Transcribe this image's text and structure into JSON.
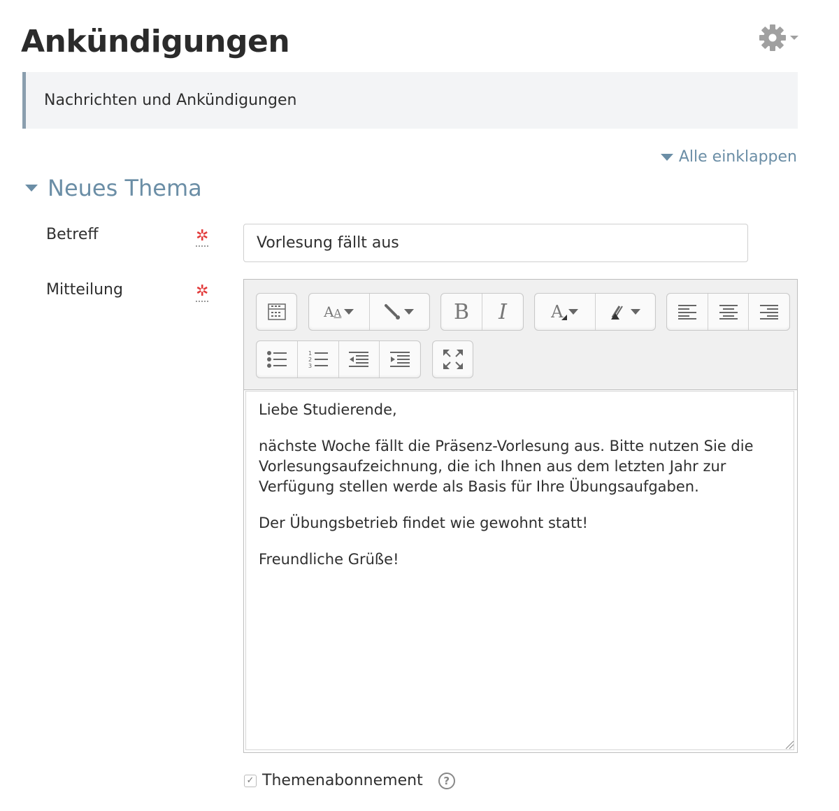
{
  "page": {
    "title": "Ankündigungen",
    "description": "Nachrichten und Ankündigungen",
    "settings_icon": "gear-icon"
  },
  "form": {
    "collapse_all": "Alle einklappen",
    "section_title": "Neues Thema",
    "subject": {
      "label": "Betreff",
      "value": "Vorlesung fällt aus",
      "required_marker": "✲"
    },
    "message": {
      "label": "Mitteilung",
      "required_marker": "✲",
      "paragraphs": [
        "Liebe Studierende,",
        "nächste Woche fällt die Präsenz-Vorlesung aus. Bitte nutzen Sie die Vorlesungsaufzeichnung, die ich Ihnen aus dem letzten Jahr zur Verfügung stellen werde als Basis für Ihre Übungsaufgaben.",
        "Der Übungsbetrieb findet wie gewohnt statt!",
        "Freundliche Grüße!"
      ]
    },
    "toolbar": {
      "row1": [
        "toolbar-toggle-icon",
        "font-size-icon",
        "paragraph-style-icon",
        "bold-icon",
        "italic-icon",
        "font-color-icon",
        "background-color-icon",
        "align-left-icon",
        "align-center-icon",
        "align-right-icon"
      ],
      "row2": [
        "bullet-list-icon",
        "numbered-list-icon",
        "outdent-icon",
        "indent-icon",
        "fullscreen-icon"
      ]
    },
    "subscription": {
      "label": "Themenabonnement",
      "checked": true
    }
  },
  "colors": {
    "accent": "#6b8ea6",
    "required": "#e23b3b",
    "intro_bg": "#f3f4f6",
    "intro_border": "#8a9eae"
  }
}
